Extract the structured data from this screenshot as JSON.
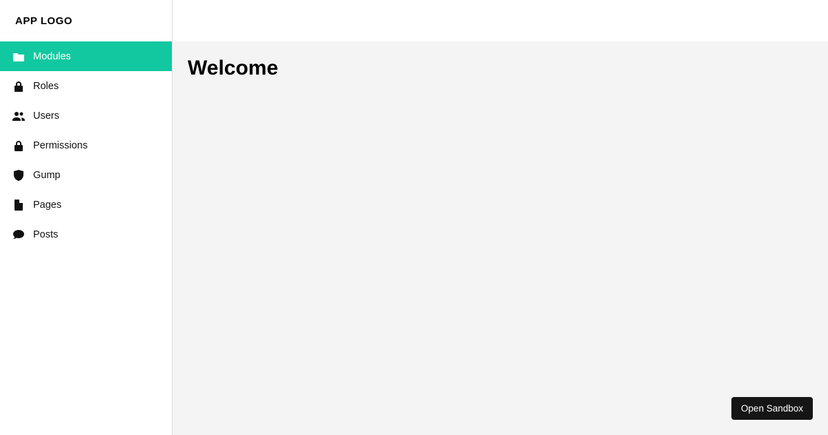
{
  "logo": "APP LOGO",
  "sidebar": {
    "items": [
      {
        "label": "Modules",
        "icon": "folder-icon",
        "active": true
      },
      {
        "label": "Roles",
        "icon": "lock-icon",
        "active": false
      },
      {
        "label": "Users",
        "icon": "users-icon",
        "active": false
      },
      {
        "label": "Permissions",
        "icon": "lock-icon",
        "active": false
      },
      {
        "label": "Gump",
        "icon": "shield-icon",
        "active": false
      },
      {
        "label": "Pages",
        "icon": "file-icon",
        "active": false
      },
      {
        "label": "Posts",
        "icon": "comment-icon",
        "active": false
      }
    ]
  },
  "main": {
    "heading": "Welcome"
  },
  "sandbox_button": "Open Sandbox",
  "colors": {
    "accent": "#12c8a0",
    "content_bg": "#f4f4f4"
  }
}
